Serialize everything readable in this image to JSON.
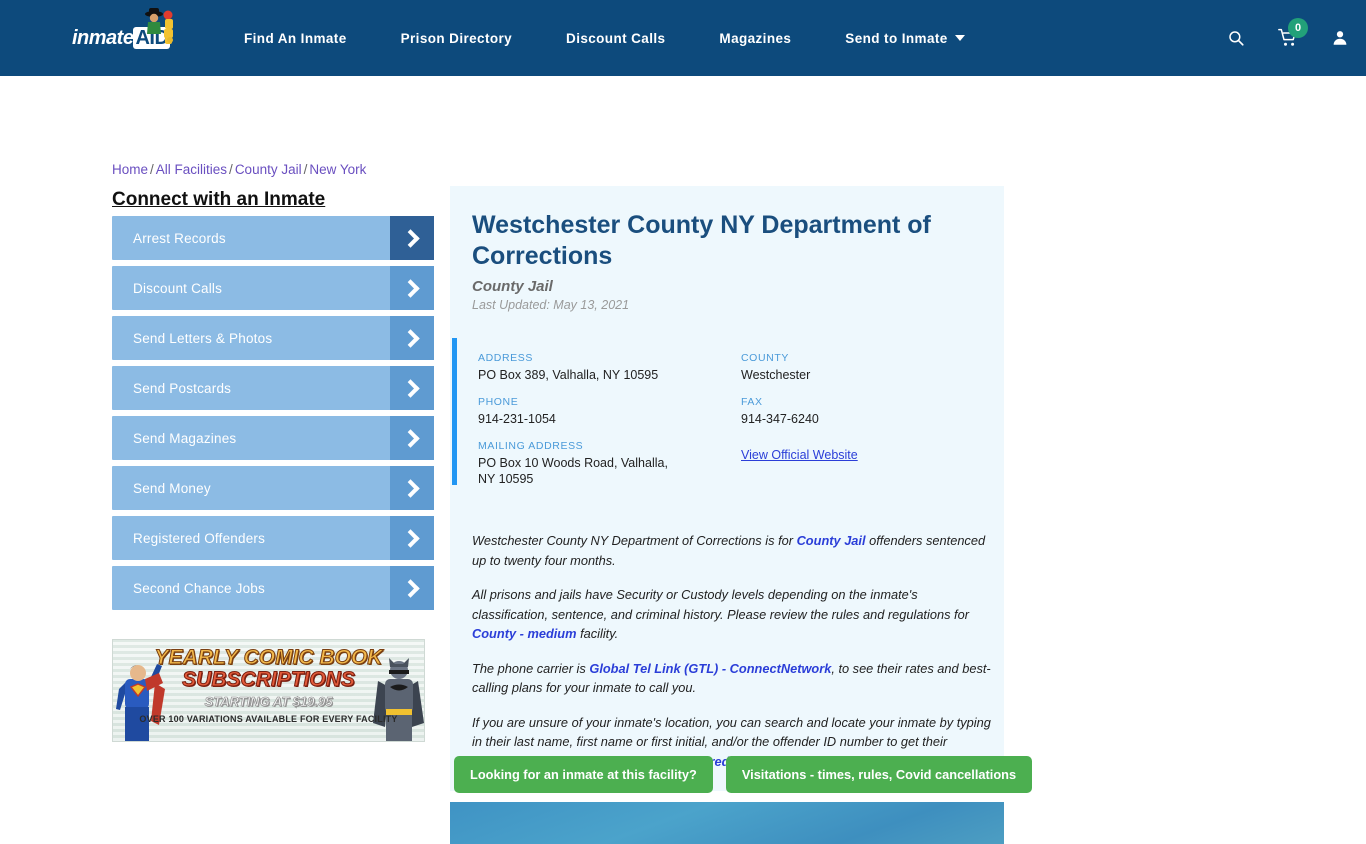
{
  "header": {
    "logo": {
      "text_a": "inmate",
      "text_b": "AID",
      "icon": "mascot-icon"
    },
    "nav": [
      {
        "label": "Find An Inmate",
        "name": "find-an-inmate"
      },
      {
        "label": "Prison Directory",
        "name": "prison-directory"
      },
      {
        "label": "Discount Calls",
        "name": "discount-calls"
      },
      {
        "label": "Magazines",
        "name": "magazines"
      },
      {
        "label": "Send to Inmate",
        "name": "send-to-inmate",
        "has_caret": true
      }
    ],
    "icons": {
      "search": "search-icon",
      "cart": "cart-icon",
      "cart_count": "0",
      "account": "user-icon"
    },
    "colors": {
      "bar": "#0d4a7c",
      "cart_badge": "#22a179"
    }
  },
  "breadcrumb": {
    "items": [
      "Home",
      "All Facilities",
      "County Jail",
      "New York"
    ],
    "separator": "/"
  },
  "sidebar": {
    "title": "Connect with an Inmate",
    "items": [
      {
        "label": "Arrest Records",
        "active": true
      },
      {
        "label": "Discount Calls",
        "active": false
      },
      {
        "label": "Send Letters & Photos",
        "active": false
      },
      {
        "label": "Send Postcards",
        "active": false
      },
      {
        "label": "Send Magazines",
        "active": false
      },
      {
        "label": "Send Money",
        "active": false
      },
      {
        "label": "Registered Offenders",
        "active": false
      },
      {
        "label": "Second Chance Jobs",
        "active": false
      }
    ],
    "ad": {
      "line1": "YEARLY COMIC BOOK",
      "line2": "SUBSCRIPTIONS",
      "line3": "STARTING AT $19.95",
      "line4": "OVER 100 VARIATIONS AVAILABLE FOR EVERY FACILITY"
    }
  },
  "facility": {
    "title": "Westchester County NY Department of Corrections",
    "type": "County Jail",
    "last_updated": "Last Updated: May 13, 2021",
    "info": {
      "address_label": "ADDRESS",
      "address_value": "PO Box 389, Valhalla, NY 10595",
      "phone_label": "PHONE",
      "phone_value": "914-231-1054",
      "mailing_label": "MAILING ADDRESS",
      "mailing_value": "PO Box 10 Woods Road, Valhalla, NY 10595",
      "county_label": "COUNTY",
      "county_value": "Westchester",
      "fax_label": "FAX",
      "fax_value": "914-347-6240",
      "website_link": "View Official Website"
    },
    "paragraphs": {
      "p1_a": "Westchester County NY Department of Corrections is for ",
      "p1_link": "County Jail",
      "p1_b": " offenders sentenced up to twenty four months.",
      "p2_a": "All prisons and jails have Security or Custody levels depending on the inmate's classification, sentence, and criminal history. Please review the rules and regulations for ",
      "p2_link": "County - medium",
      "p2_b": " facility.",
      "p3_a": "The phone carrier is ",
      "p3_link": "Global Tel Link (GTL) - ConnectNetwork",
      "p3_b": ", to see their rates and best-calling plans for your inmate to call you.",
      "p4_a": "If you are unsure of your inmate's location, you can search and locate your inmate by typing in their last name, first name or first initial, and/or the offender ID number to get their accurate information immediately ",
      "p4_link": "Registered Offenders"
    }
  },
  "cta": {
    "button1": "Looking for an inmate at this facility?",
    "button2": "Visitations - times, rules, Covid cancellations",
    "color": "#4caf50"
  }
}
